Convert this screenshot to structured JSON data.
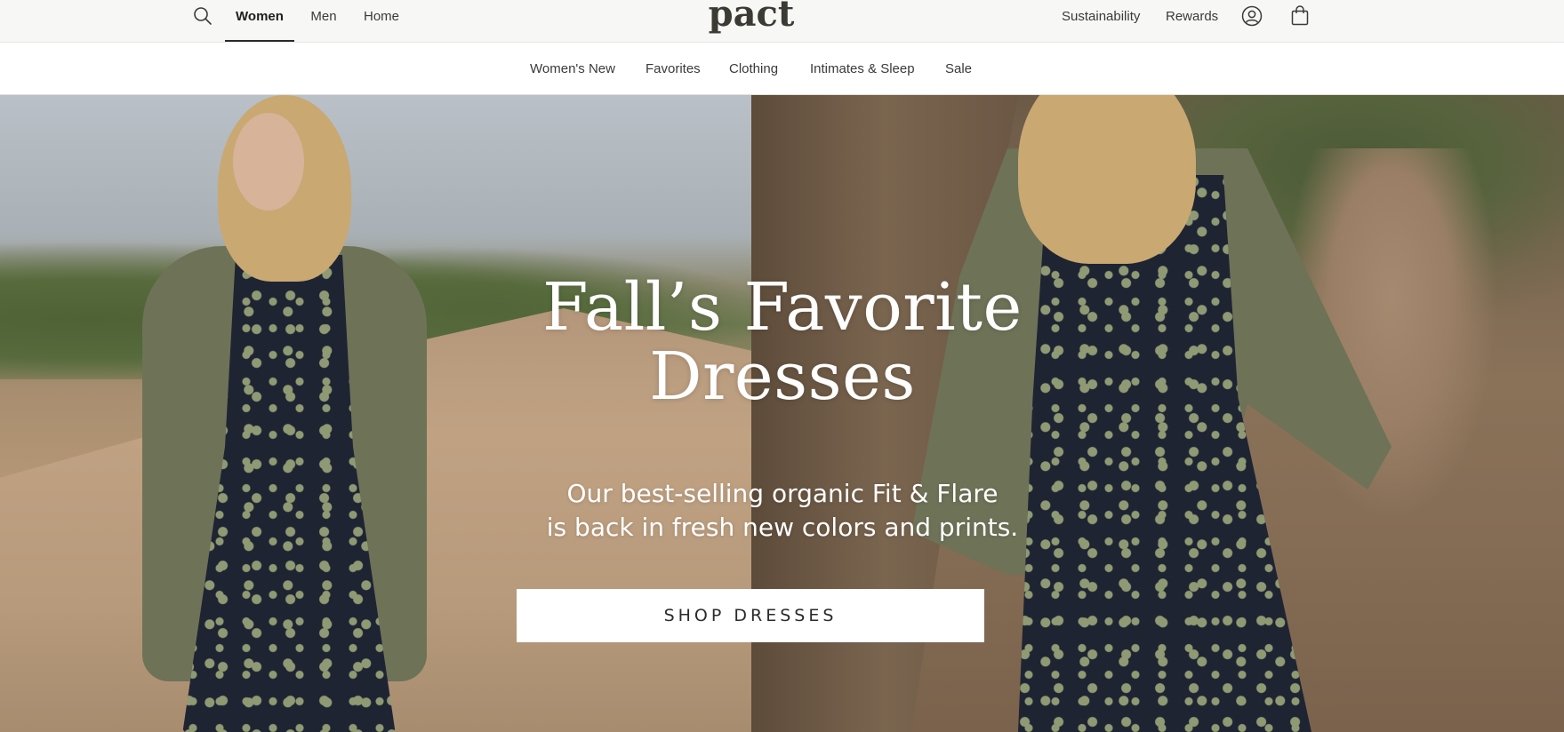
{
  "brand": {
    "logo_text": "pact"
  },
  "topbar": {
    "search_icon": "search-icon",
    "gender_tabs": [
      {
        "label": "Women",
        "active": true
      },
      {
        "label": "Men",
        "active": false
      },
      {
        "label": "Home",
        "active": false
      }
    ],
    "utility_links": [
      {
        "label": "Sustainability"
      },
      {
        "label": "Rewards"
      }
    ],
    "account_icon": "account-icon",
    "cart_icon": "shopping-bag-icon"
  },
  "categories": [
    {
      "label": "Women's New"
    },
    {
      "label": "Favorites"
    },
    {
      "label": "Clothing"
    },
    {
      "label": "Intimates & Sleep"
    },
    {
      "label": "Sale"
    }
  ],
  "hero": {
    "title_line1": "Fall’s Favorite",
    "title_line2": "Dresses",
    "subtitle_line1": "Our best-selling organic Fit & Flare",
    "subtitle_line2": "is back in fresh new colors and prints.",
    "cta_label": "SHOP DRESSES"
  },
  "colors": {
    "topbar_bg": "#f7f7f5",
    "logo": "#3b3a33",
    "text": "#3a3a3a",
    "cta_bg": "#ffffff"
  }
}
